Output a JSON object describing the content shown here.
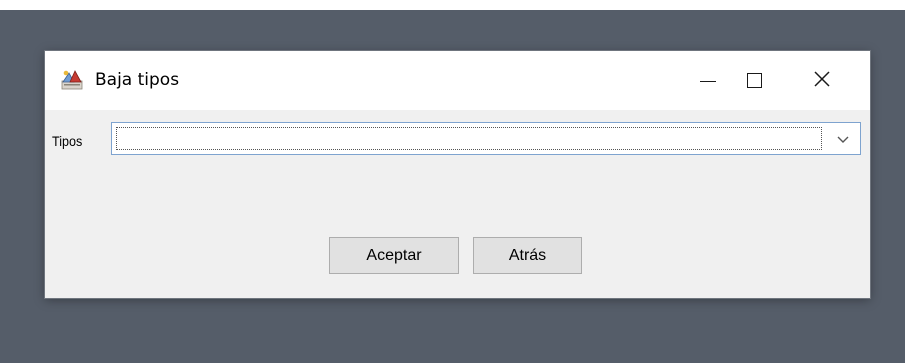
{
  "window": {
    "title": "Baja tipos",
    "icon": "java-app-icon",
    "controls": {
      "minimize": "minimize-icon",
      "maximize": "maximize-icon",
      "close": "close-icon"
    }
  },
  "form": {
    "tipos_label": "Tipos",
    "tipos_value": ""
  },
  "buttons": {
    "accept_label": "Aceptar",
    "back_label": "Atrás"
  },
  "colors": {
    "desktop": "#555d69",
    "titlebar": "#ffffff",
    "window_body": "#f0f0f0",
    "combo_border": "#7ea3cf",
    "button_face": "#e1e1e1",
    "button_border": "#adadad"
  }
}
